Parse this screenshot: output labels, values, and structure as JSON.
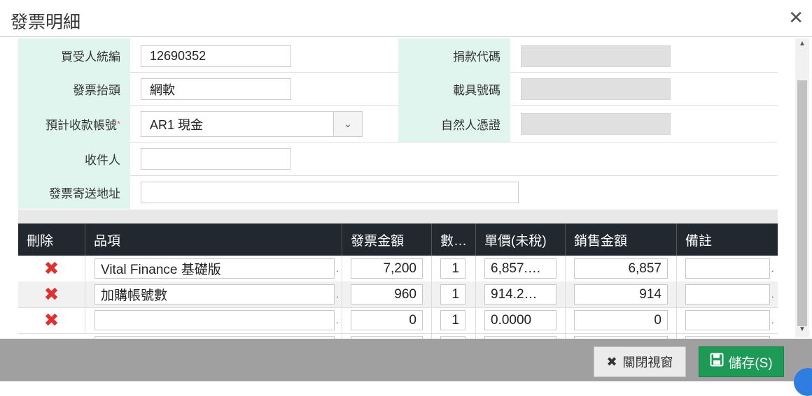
{
  "dialog": {
    "title": "發票明細",
    "close_icon": "close-icon"
  },
  "form": {
    "buyer_id": {
      "label": "買受人統編",
      "value": "12690352"
    },
    "invoice_title": {
      "label": "發票抬頭",
      "value": "網軟"
    },
    "receive_account": {
      "label": "預計收款帳號",
      "required_mark": "*",
      "value": "AR1 現金"
    },
    "recipient": {
      "label": "收件人",
      "value": ""
    },
    "address": {
      "label": "發票寄送地址",
      "value": ""
    },
    "donation_code": {
      "label": "捐款代碼",
      "value": ""
    },
    "carrier_no": {
      "label": "載具號碼",
      "value": ""
    },
    "natural_person_cert": {
      "label": "自然人憑證",
      "value": ""
    }
  },
  "table": {
    "columns": [
      "刪除",
      "品項",
      "發票金額",
      "數…",
      "單價(未稅)",
      "銷售金額",
      "備註"
    ],
    "rows": [
      {
        "item": "Vital Finance 基礎版",
        "amount": "7,200",
        "qty": "1",
        "unit_price": "6,857.…",
        "sales": "6,857",
        "note": ""
      },
      {
        "item": "加購帳號數",
        "amount": "960",
        "qty": "1",
        "unit_price": "914.2…",
        "sales": "914",
        "note": ""
      },
      {
        "item": "",
        "amount": "0",
        "qty": "1",
        "unit_price": "0.0000",
        "sales": "0",
        "note": ""
      }
    ]
  },
  "footer": {
    "close_label": "關閉視窗",
    "save_label": "儲存(S)"
  },
  "colors": {
    "label_bg": "#dff5ee",
    "header_bg": "#222830",
    "save_bg": "#1e9a57",
    "delete": "#e03030"
  }
}
